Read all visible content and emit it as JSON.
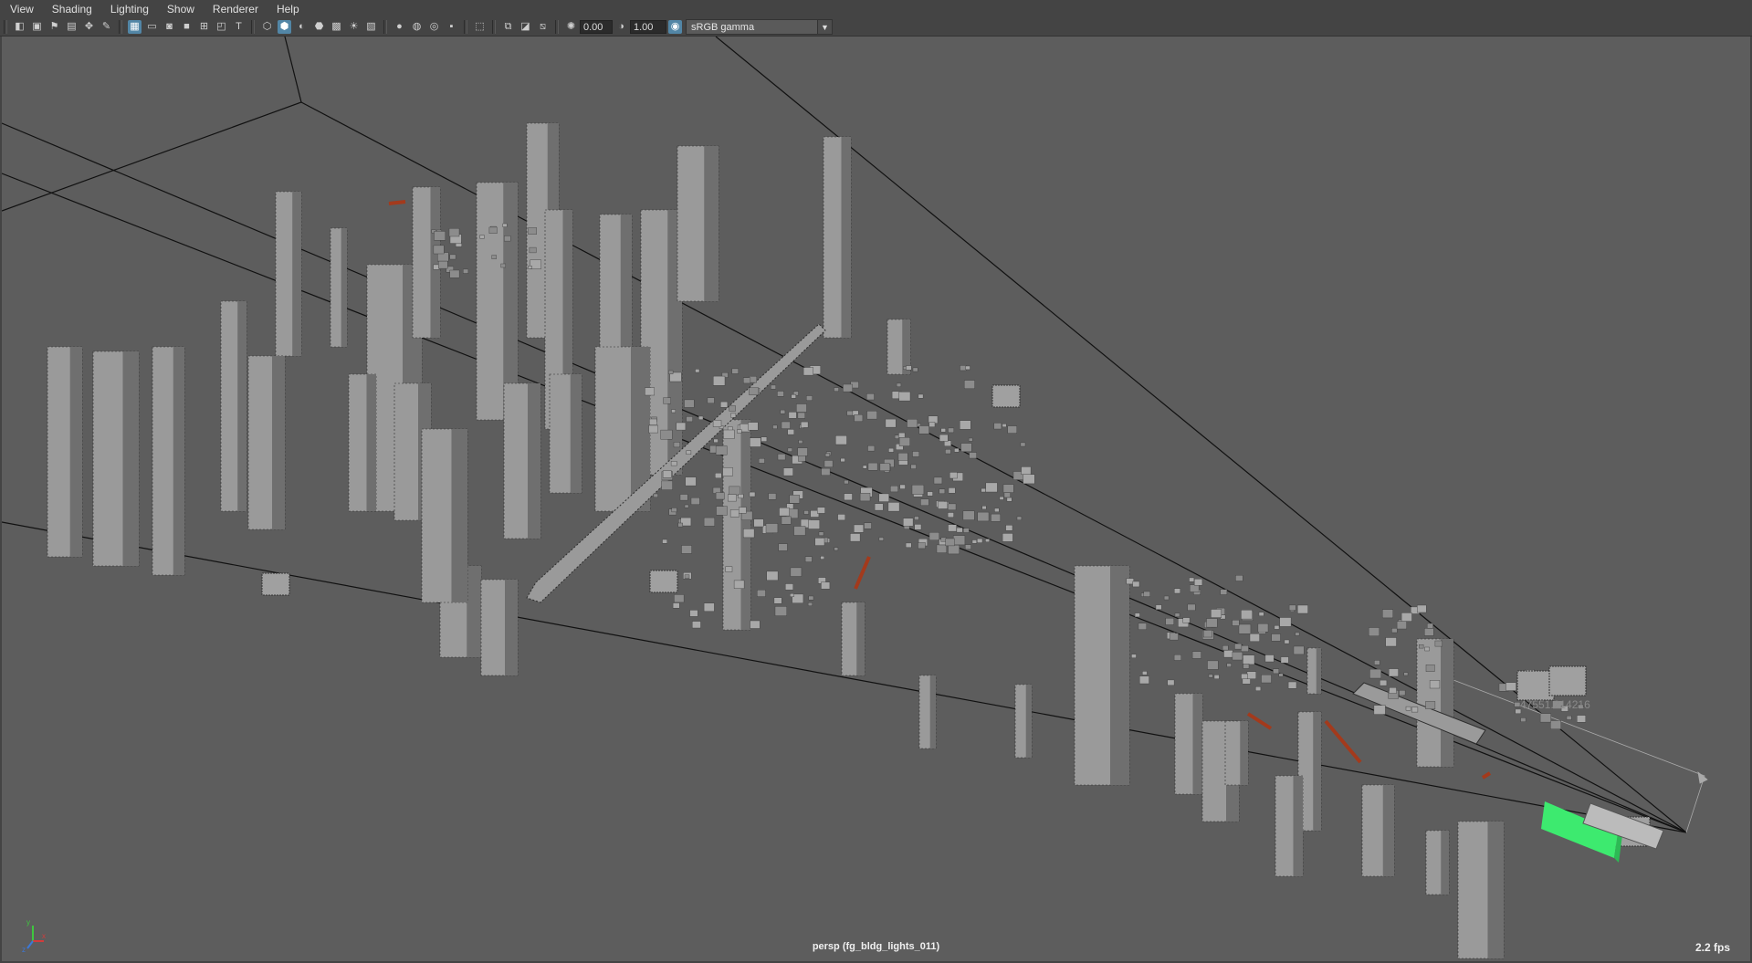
{
  "menu": {
    "items": [
      "View",
      "Shading",
      "Lighting",
      "Show",
      "Renderer",
      "Help"
    ]
  },
  "toolbar": {
    "icons": [
      "select-camera-icon",
      "camera-attributes-icon",
      "bookmark-icon",
      "image-plane-icon",
      "2d-pan-zoom-icon",
      "grease-pencil-icon",
      "grid-icon",
      "film-gate-icon",
      "resolution-gate-icon",
      "gate-mask-icon",
      "field-chart-icon",
      "safe-action-icon",
      "safe-title-icon",
      "wireframe-icon",
      "smooth-shade-icon",
      "wireframe-on-shaded-icon",
      "textured-icon",
      "use-all-lights-icon",
      "shadows-icon",
      "screen-space-ambient-occlusion-icon",
      "motion-blur-icon",
      "anti-aliasing-icon",
      "depth-of-field-icon",
      "isolate-select-icon",
      "xray-icon",
      "xray-active-components-icon",
      "xray-joints-icon",
      "exposure-icon",
      "gamma-icon",
      "color-management-icon"
    ],
    "exposure_value": "0.00",
    "gamma_value": "1.00",
    "color_space": "sRGB gamma"
  },
  "viewport": {
    "camera_label": "persp (fg_bldg_lights_011)",
    "fps": "2.2 fps",
    "distance_readout": "47551.214216",
    "axis_labels": {
      "x": "x",
      "y": "y",
      "z": "z"
    },
    "colors": {
      "background": "#5d5d5d",
      "geometry": "#9a9a9a",
      "geometry_dark": "#2e2e2e",
      "frustum_line": "#111111",
      "selected": "#3dea6f",
      "light_locator": "#a33a1c"
    }
  }
}
